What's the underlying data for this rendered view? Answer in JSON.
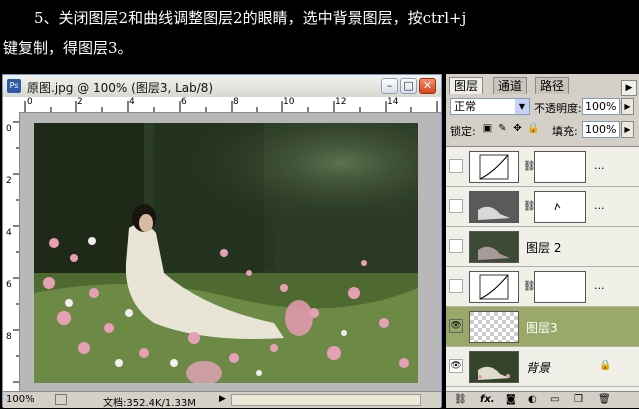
{
  "instruction": {
    "line1": "5、关闭图层2和曲线调整图层2的眼睛，选中背景图层，按ctrl+j",
    "line2": "键复制，得图层3。"
  },
  "document": {
    "title": "原图.jpg @ 100% (图层3, Lab/8)",
    "ps_badge": "Ps",
    "ruler_top": [
      "0",
      "2",
      "4",
      "6",
      "8",
      "10",
      "12",
      "14"
    ],
    "ruler_left": [
      "0",
      "2",
      "4",
      "6",
      "8"
    ],
    "zoom": "100%",
    "doc_size": "文档:352.4K/1.33M",
    "min_glyph": "–",
    "max_glyph": "□",
    "close_glyph": "✕"
  },
  "panel": {
    "tabs": [
      "图层",
      "通道",
      "路径"
    ],
    "blend_mode": "正常",
    "opacity_label": "不透明度:",
    "opacity_value": "100%",
    "lock_label": "锁定:",
    "fill_label": "填充:",
    "fill_value": "100%",
    "layers": [
      {
        "name": "",
        "type": "curves",
        "visible": false
      },
      {
        "name": "",
        "type": "masked-image",
        "visible": false
      },
      {
        "name": "图层 2",
        "type": "image",
        "visible": false
      },
      {
        "name": "",
        "type": "curves",
        "visible": false
      },
      {
        "name": "图层3",
        "type": "transparent",
        "visible": true,
        "selected": true
      },
      {
        "name": "背景",
        "type": "background",
        "visible": true,
        "locked": true
      }
    ],
    "more": "...",
    "fx_label": "fx.",
    "selected_color": "#9aa86a"
  }
}
